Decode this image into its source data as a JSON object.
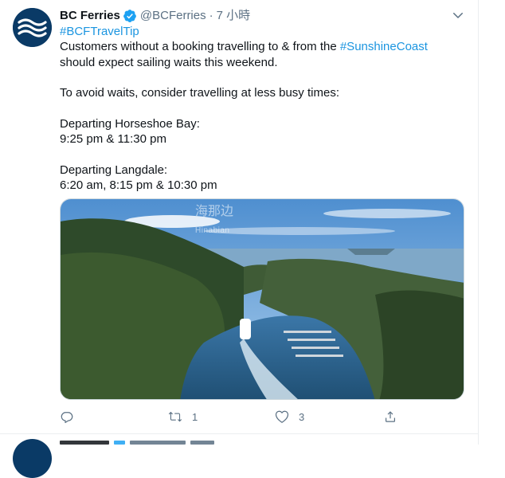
{
  "tweet": {
    "display_name": "BC Ferries",
    "handle": "@BCFerries",
    "separator": "·",
    "time": "7 小時",
    "hashtag": "#BCFTravelTip",
    "line1_prefix": "Customers without a booking travelling to & from the ",
    "line1_link": "#SunshineCoast",
    "line2": "should expect sailing waits this weekend.",
    "line3": "To avoid waits, consider travelling at less busy times:",
    "line4": "Departing Horseshoe Bay:",
    "line5": "9:25 pm & 11:30 pm",
    "line6": "Departing Langdale:",
    "line7": "6:20 am, 8:15 pm & 10:30 pm",
    "watermark": "海那边",
    "watermark_sub": "Hinabian",
    "reply_count": "",
    "retweet_count": "1",
    "like_count": "3"
  },
  "icons": {
    "verified": "verified-badge-icon",
    "caret": "chevron-down-icon",
    "reply": "reply-icon",
    "retweet": "retweet-icon",
    "like": "heart-icon",
    "share": "share-icon"
  },
  "colors": {
    "link": "#1b95e0",
    "muted": "#5b7083",
    "text": "#0f1419",
    "brand": "#0a3a66"
  }
}
